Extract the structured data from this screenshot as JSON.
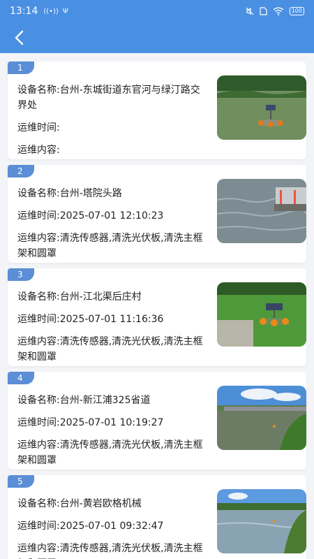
{
  "status": {
    "time": "13:14",
    "signal": "((•))",
    "usb": "Ψ",
    "battery": "100"
  },
  "records": [
    {
      "num": "1",
      "device_name": "设备名称:台州-东城街道东官河与绿汀路交界处",
      "maint_time": "运维时间:",
      "maint_content": "运维内容:"
    },
    {
      "num": "2",
      "device_name": "设备名称:台州-塔院头路",
      "maint_time": "运维时间:2025-07-01 12:10:23",
      "maint_content": "运维内容:清洗传感器,清洗光伏板,清洗主框架和圆罩"
    },
    {
      "num": "3",
      "device_name": "设备名称:台州-江北渠后庄村",
      "maint_time": "运维时间:2025-07-01 11:16:36",
      "maint_content": "运维内容:清洗传感器,清洗光伏板,清洗主框架和圆罩"
    },
    {
      "num": "4",
      "device_name": "设备名称:台州-新江浦325省道",
      "maint_time": "运维时间:2025-07-01 10:19:27",
      "maint_content": "运维内容:清洗传感器,清洗光伏板,清洗主框架和圆罩"
    },
    {
      "num": "5",
      "device_name": "设备名称:台州-黄岩欧格机械",
      "maint_time": "运维时间:2025-07-01 09:32:47",
      "maint_content": "运维内容:清洗传感器,清洗光伏板,清洗主框架和圆罩"
    }
  ]
}
